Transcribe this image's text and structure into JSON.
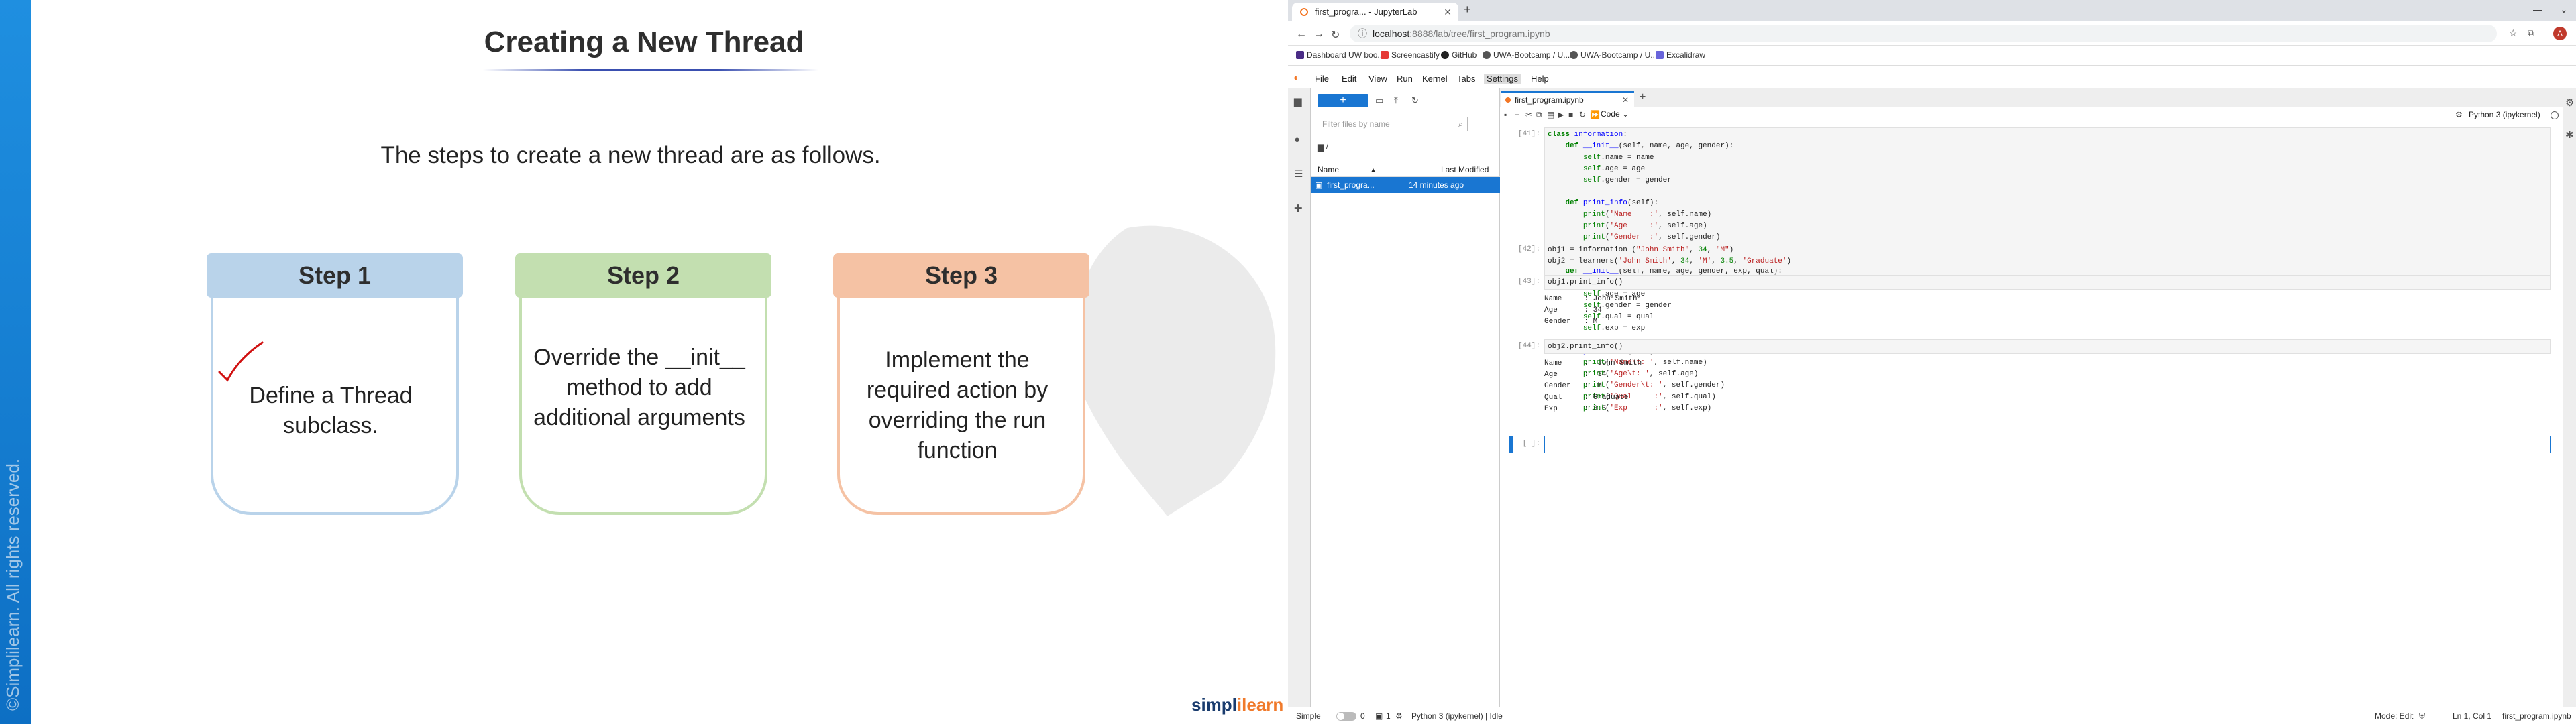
{
  "slide": {
    "title": "Creating a New Thread",
    "intro": "The steps to create a new thread are as follows.",
    "copyright": "©Simplilearn. All rights reserved.",
    "brand_a": "simpl",
    "brand_b": "ilearn",
    "steps": [
      {
        "head": "Step 1",
        "text": "Define a Thread subclass."
      },
      {
        "head": "Step 2",
        "text": "Override the __init__ method to add additional arguments"
      },
      {
        "head": "Step 3",
        "text": "Implement the required action by overriding the run function"
      }
    ]
  },
  "browser": {
    "tab_title": "first_progra... - JupyterLab",
    "url_host": "localhost",
    "url_path": ":8888/lab/tree/first_program.ipynb",
    "bookmarks": [
      "Dashboard UW boo...",
      "Screencastify",
      "GitHub",
      "UWA-Bootcamp / U...",
      "UWA-Bootcamp / U...",
      "Excalidraw"
    ],
    "avatar": "A"
  },
  "jupyter": {
    "menu": [
      "File",
      "Edit",
      "View",
      "Run",
      "Kernel",
      "Tabs",
      "Settings",
      "Help"
    ],
    "filter_placeholder": "Filter files by name",
    "breadcrumb": "/",
    "col_name": "Name",
    "col_modified": "Last Modified",
    "file_name": "first_progra...",
    "file_modified": "14 minutes ago",
    "nb_tab": "first_program.ipynb",
    "cell_type": "Code",
    "kernel": "Python 3 (ipykernel)",
    "prompts": [
      "[41]:",
      "[42]:",
      "[43]:",
      "[44]:",
      "[ ]:"
    ],
    "out1": "Name     : John Smith\nAge      : 34\nGender   : M",
    "out2": "Name     :  John Smith\nAge      :  34\nGender   :  M\nQual     : Graduate\nExp      : 3.5",
    "status": {
      "mode": "Simple",
      "zero": "0",
      "one": "1",
      "kernel_state": "Python 3 (ipykernel) | Idle",
      "edit_mode": "Mode: Edit",
      "pos": "Ln 1, Col 1",
      "file": "first_program.ipynb"
    }
  }
}
